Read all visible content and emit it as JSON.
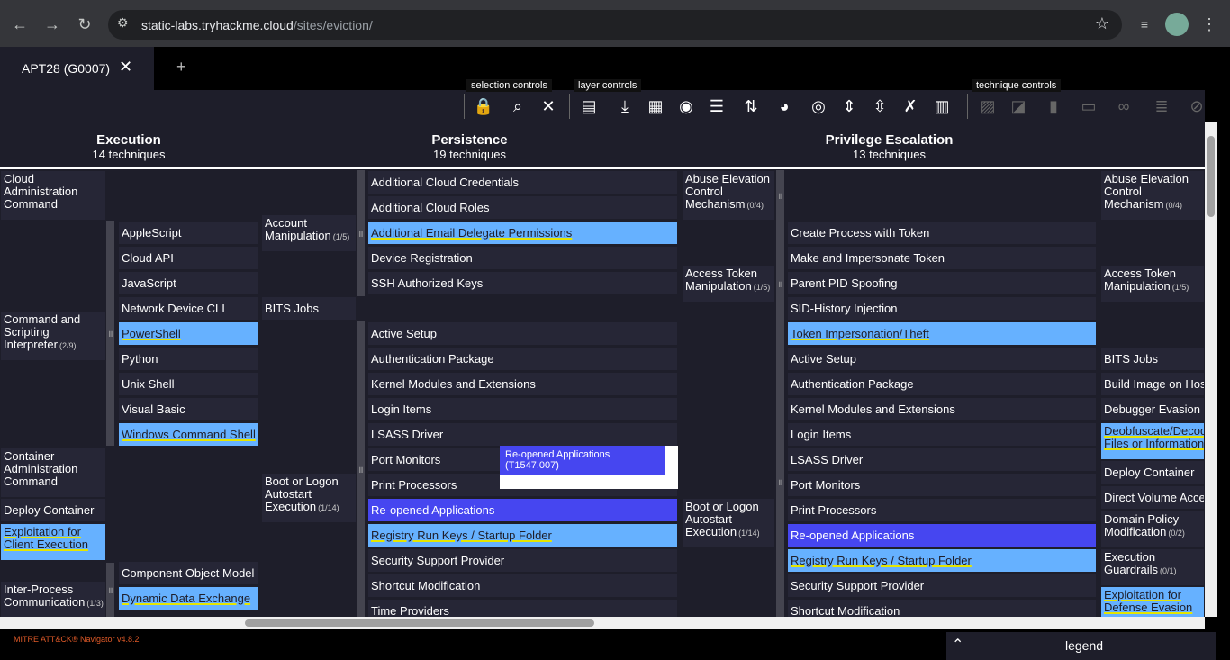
{
  "browser": {
    "url_domain": "static-labs.tryhackme.cloud",
    "url_path": "/sites/eviction/"
  },
  "tab": {
    "title": "APT28 (G0007)"
  },
  "toolbar": {
    "selection_label": "selection controls",
    "layer_label": "layer controls",
    "technique_label": "technique controls"
  },
  "tactics": [
    {
      "name": "Execution",
      "count": "14 techniques"
    },
    {
      "name": "Persistence",
      "count": "19 techniques"
    },
    {
      "name": "Privilege Escalation",
      "count": "13 techniques"
    }
  ],
  "cells": [
    {
      "t": "Cloud Administration Command",
      "c": ""
    },
    {
      "t": "AppleScript",
      "c": ""
    },
    {
      "t": "Cloud API",
      "c": ""
    },
    {
      "t": "JavaScript",
      "c": ""
    },
    {
      "t": "Network Device CLI",
      "c": ""
    },
    {
      "t": "Command and Scripting Interpreter",
      "c": "(2/9)"
    },
    {
      "t": "PowerShell",
      "c": ""
    },
    {
      "t": "Python",
      "c": ""
    },
    {
      "t": "Unix Shell",
      "c": ""
    },
    {
      "t": "Visual Basic",
      "c": ""
    },
    {
      "t": "Windows Command Shell",
      "c": ""
    },
    {
      "t": "Container Administration Command",
      "c": ""
    },
    {
      "t": "Deploy Container",
      "c": ""
    },
    {
      "t": "Exploitation for Client Execution",
      "c": ""
    },
    {
      "t": "Component Object Model",
      "c": ""
    },
    {
      "t": "Dynamic Data Exchange",
      "c": ""
    },
    {
      "t": "Inter-Process Communication",
      "c": "(1/3)"
    },
    {
      "t": "Account Manipulation",
      "c": "(1/5)"
    },
    {
      "t": "BITS Jobs",
      "c": ""
    },
    {
      "t": "Boot or Logon Autostart Execution",
      "c": "(1/14)"
    },
    {
      "t": "Additional Cloud Credentials",
      "c": ""
    },
    {
      "t": "Additional Cloud Roles",
      "c": ""
    },
    {
      "t": "Additional Email Delegate Permissions",
      "c": ""
    },
    {
      "t": "Device Registration",
      "c": ""
    },
    {
      "t": "SSH Authorized Keys",
      "c": ""
    },
    {
      "t": "Active Setup",
      "c": ""
    },
    {
      "t": "Authentication Package",
      "c": ""
    },
    {
      "t": "Kernel Modules and Extensions",
      "c": ""
    },
    {
      "t": "Login Items",
      "c": ""
    },
    {
      "t": "LSASS Driver",
      "c": ""
    },
    {
      "t": "Port Monitors",
      "c": ""
    },
    {
      "t": "Print Processors",
      "c": ""
    },
    {
      "t": "Re-opened Applications",
      "c": ""
    },
    {
      "t": "Registry Run Keys / Startup Folder",
      "c": ""
    },
    {
      "t": "Security Support Provider",
      "c": ""
    },
    {
      "t": "Shortcut Modification",
      "c": ""
    },
    {
      "t": "Time Providers",
      "c": ""
    },
    {
      "t": "Abuse Elevation Control Mechanism",
      "c": "(0/4)"
    },
    {
      "t": "Access Token Manipulation",
      "c": "(1/5)"
    },
    {
      "t": "Boot or Logon Autostart Execution",
      "c": "(1/14)"
    },
    {
      "t": "Create Process with Token",
      "c": ""
    },
    {
      "t": "Make and Impersonate Token",
      "c": ""
    },
    {
      "t": "Parent PID Spoofing",
      "c": ""
    },
    {
      "t": "SID-History Injection",
      "c": ""
    },
    {
      "t": "Token Impersonation/Theft",
      "c": ""
    },
    {
      "t": "Active Setup",
      "c": ""
    },
    {
      "t": "Authentication Package",
      "c": ""
    },
    {
      "t": "Kernel Modules and Extensions",
      "c": ""
    },
    {
      "t": "Login Items",
      "c": ""
    },
    {
      "t": "LSASS Driver",
      "c": ""
    },
    {
      "t": "Port Monitors",
      "c": ""
    },
    {
      "t": "Print Processors",
      "c": ""
    },
    {
      "t": "Re-opened Applications",
      "c": ""
    },
    {
      "t": "Registry Run Keys / Startup Folder",
      "c": ""
    },
    {
      "t": "Security Support Provider",
      "c": ""
    },
    {
      "t": "Shortcut Modification",
      "c": ""
    },
    {
      "t": "Abuse Elevation Control Mechanism",
      "c": "(0/4)"
    },
    {
      "t": "Access Token Manipulation",
      "c": "(1/5)"
    },
    {
      "t": "BITS Jobs",
      "c": ""
    },
    {
      "t": "Build Image on Host",
      "c": ""
    },
    {
      "t": "Debugger Evasion",
      "c": ""
    },
    {
      "t": "Deobfuscate/Decode Files or Information",
      "c": ""
    },
    {
      "t": "Deploy Container",
      "c": ""
    },
    {
      "t": "Direct Volume Access",
      "c": ""
    },
    {
      "t": "Domain Policy Modification",
      "c": "(0/2)"
    },
    {
      "t": "Execution Guardrails",
      "c": "(0/1)"
    },
    {
      "t": "Exploitation for Defense Evasion",
      "c": ""
    }
  ],
  "tooltip": "Re-opened Applications (T1547.007)",
  "footer": {
    "version": "MITRE ATT&CK® Navigator v4.8.2",
    "legend": "legend"
  }
}
